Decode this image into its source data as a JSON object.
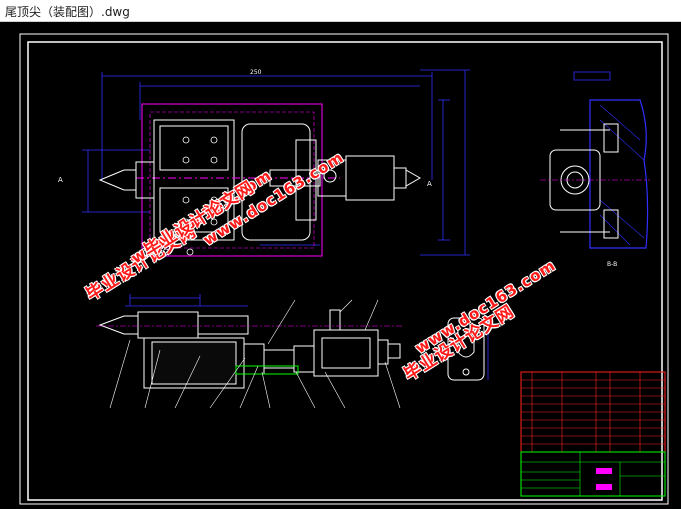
{
  "window": {
    "title": "尾顶尖（装配图）.dwg"
  },
  "drawing": {
    "background": "#000000",
    "frame_color": "#ffffff",
    "dimension_color": "#3030ff",
    "outline_color": "#ff00ff",
    "table_color": "#ff2020",
    "title_color": "#00ff00",
    "section_label": "B-B",
    "view_label": "A-A"
  },
  "watermarks": [
    {
      "text": "www.doc163.com"
    },
    {
      "text": "毕业设计论文网"
    },
    {
      "text": "www.doc163.com"
    },
    {
      "text": "毕业设计论文网"
    },
    {
      "text": "毕业设计论文网"
    },
    {
      "text": "www.doc163.com"
    }
  ]
}
